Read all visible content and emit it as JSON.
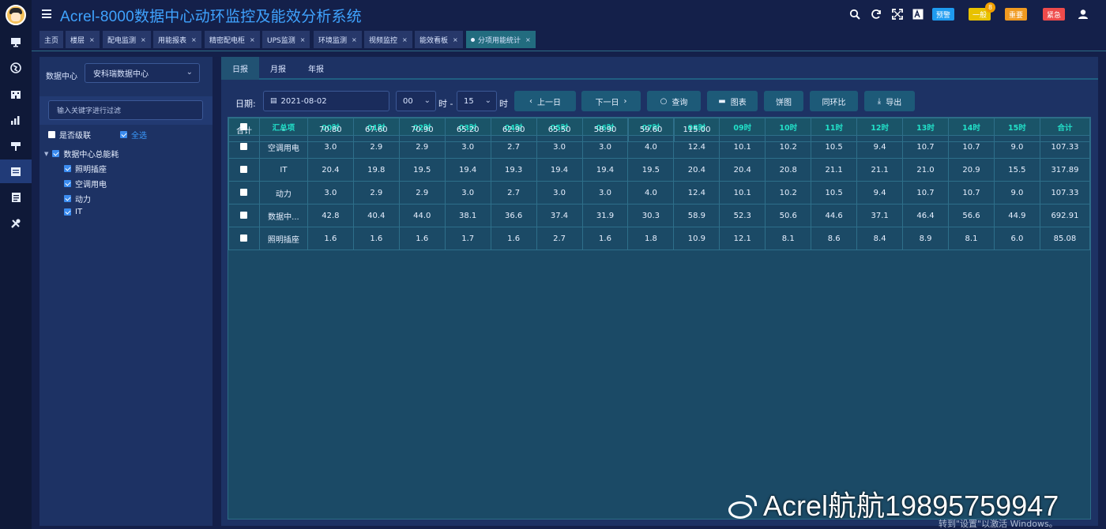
{
  "app": {
    "title": "Acrel-8000数据中心动环监控及能效分析系统"
  },
  "header": {
    "alerts": [
      {
        "label": "预警",
        "color": "#1e9bf0"
      },
      {
        "label": "一般",
        "color": "#e8c200",
        "count": "8"
      },
      {
        "label": "重要",
        "color": "#f09a20"
      },
      {
        "label": "紧急",
        "color": "#ee4b4b"
      }
    ],
    "icons": [
      "search-icon",
      "refresh-icon",
      "fullscreen-icon",
      "font-size-icon",
      "user-icon"
    ]
  },
  "rail_icons": [
    "monitor-icon",
    "globe-icon",
    "building-icon",
    "bar-chart-icon",
    "sign-icon",
    "report-icon",
    "document-icon",
    "tools-icon"
  ],
  "page_tabs": [
    {
      "label": "主页",
      "closable": false
    },
    {
      "label": "楼层",
      "closable": true
    },
    {
      "label": "配电监测",
      "closable": true
    },
    {
      "label": "用能报表",
      "closable": true
    },
    {
      "label": "精密配电柜",
      "closable": true
    },
    {
      "label": "UPS监测",
      "closable": true
    },
    {
      "label": "环境监测",
      "closable": true
    },
    {
      "label": "视频监控",
      "closable": true
    },
    {
      "label": "能效看板",
      "closable": true
    },
    {
      "label": "分项用能统计",
      "closable": true,
      "active": true
    }
  ],
  "left_panel": {
    "datacenter_label": "数据中心",
    "datacenter_value": "安科瑞数据中心",
    "filter_placeholder": "输入关键字进行过滤",
    "cascade_label": "是否级联",
    "select_all_label": "全选",
    "tree_root": "数据中心总能耗",
    "tree_children": [
      "照明插座",
      "空调用电",
      "动力",
      "IT"
    ]
  },
  "report": {
    "tabs": [
      "日报",
      "月报",
      "年报"
    ],
    "date_label": "日期:",
    "date_value": "2021-08-02",
    "hour_from": "00",
    "hour_sep": "时 -",
    "hour_to": "15",
    "hour_unit": "时",
    "buttons": {
      "prev": "上一日",
      "next": "下一日",
      "query": "查询",
      "chart": "图表",
      "pie": "饼图",
      "yoy": "同环比",
      "export": "导出"
    }
  },
  "table": {
    "columns": [
      "汇总项",
      "00时",
      "01时",
      "02时",
      "03时",
      "04时",
      "05时",
      "06时",
      "07时",
      "08时",
      "09时",
      "10时",
      "11时",
      "12时",
      "13时",
      "14时",
      "15时",
      "合计"
    ],
    "rows": [
      [
        "空调用电",
        "3.0",
        "2.9",
        "2.9",
        "3.0",
        "2.7",
        "3.0",
        "3.0",
        "4.0",
        "12.4",
        "10.1",
        "10.2",
        "10.5",
        "9.4",
        "10.7",
        "10.7",
        "9.0",
        "107.33"
      ],
      [
        "IT",
        "20.4",
        "19.8",
        "19.5",
        "19.4",
        "19.3",
        "19.4",
        "19.4",
        "19.5",
        "20.4",
        "20.4",
        "20.8",
        "21.1",
        "21.1",
        "21.0",
        "20.9",
        "15.5",
        "317.89"
      ],
      [
        "动力",
        "3.0",
        "2.9",
        "2.9",
        "3.0",
        "2.7",
        "3.0",
        "3.0",
        "4.0",
        "12.4",
        "10.1",
        "10.2",
        "10.5",
        "9.4",
        "10.7",
        "10.7",
        "9.0",
        "107.33"
      ],
      [
        "数据中...",
        "42.8",
        "40.4",
        "44.0",
        "38.1",
        "36.6",
        "37.4",
        "31.9",
        "30.3",
        "58.9",
        "52.3",
        "50.6",
        "44.6",
        "37.1",
        "46.4",
        "56.6",
        "44.9",
        "692.91"
      ],
      [
        "照明插座",
        "1.6",
        "1.6",
        "1.6",
        "1.7",
        "1.6",
        "2.7",
        "1.6",
        "1.8",
        "10.9",
        "12.1",
        "8.1",
        "8.6",
        "8.4",
        "8.9",
        "8.1",
        "6.0",
        "85.08"
      ]
    ],
    "footer": [
      "合计",
      "-",
      "70.80",
      "67.60",
      "70.90",
      "65.20",
      "62.90",
      "65.50",
      "58.90",
      "59.60",
      "115.00",
      "",
      "",
      "",
      "",
      "",
      "",
      "",
      ""
    ]
  },
  "watermark": {
    "text": "Acrel航航19895759947",
    "activation": "转到\"设置\"以激活 Windows。"
  }
}
